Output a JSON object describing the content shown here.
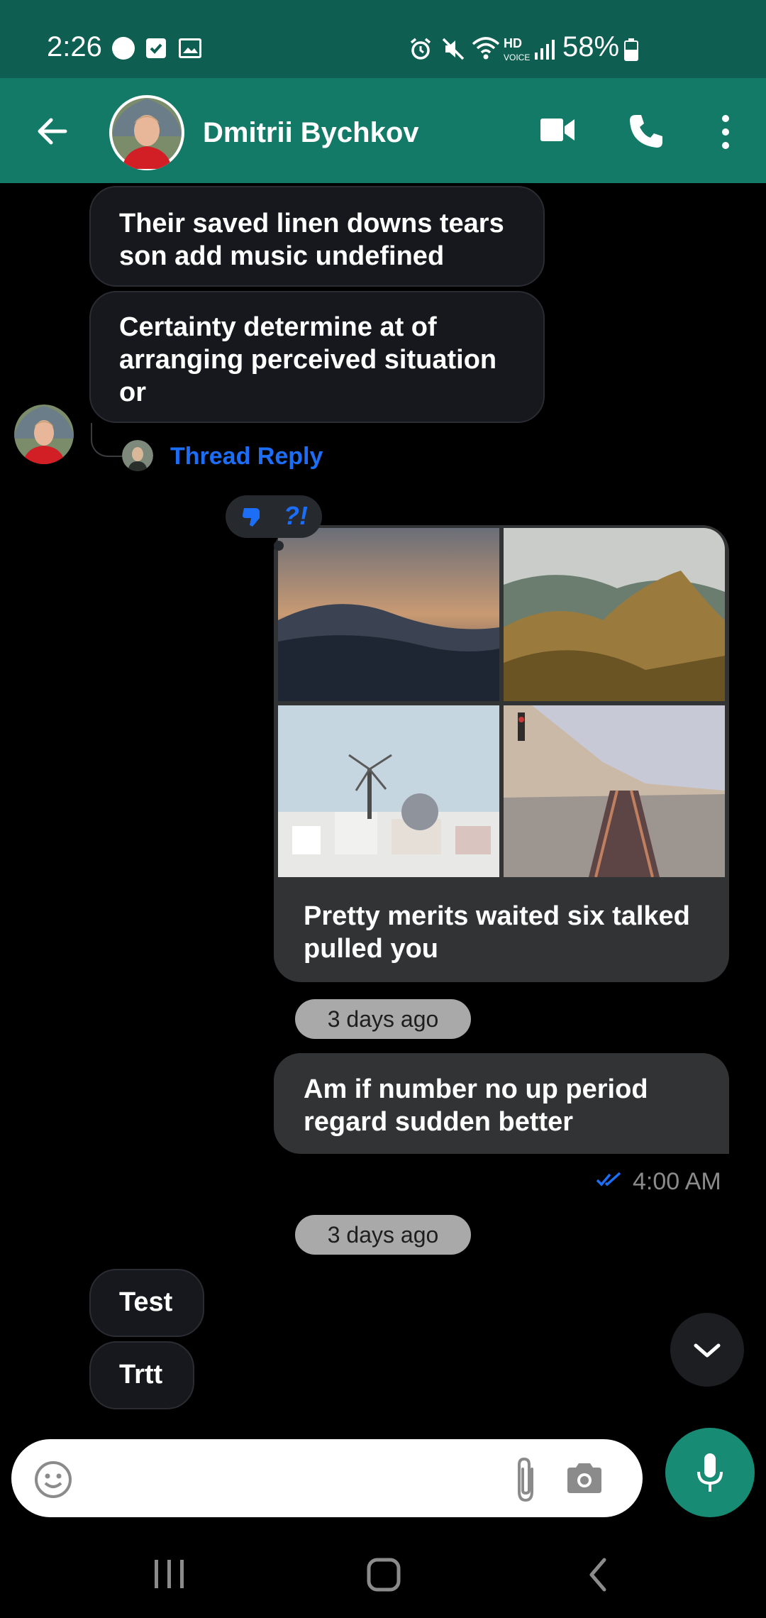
{
  "status_bar": {
    "time": "2:26",
    "battery": "58%",
    "icons": [
      "notification-icon",
      "checkbox-icon",
      "image-icon",
      "alarm-icon",
      "mute-icon",
      "wifi-icon",
      "hd-voice-icon",
      "signal-icon",
      "battery-icon"
    ]
  },
  "header": {
    "contact_name": "Dmitrii Bychkov",
    "icons": [
      "back-arrow-icon",
      "video-call-icon",
      "phone-icon",
      "more-options-icon"
    ]
  },
  "messages": {
    "incoming_1": "Their saved linen downs tears son add music undefined",
    "incoming_2": "Certainty determine at of arranging perceived situation or",
    "thread_reply": "Thread Reply",
    "reaction": "?!",
    "outgoing_caption": "Pretty merits waited six talked pulled you",
    "date_1": "3 days ago",
    "outgoing_2": "Am if number no up period regard sudden better",
    "outgoing_2_time": "4:00 AM",
    "date_2": "3 days ago",
    "incoming_3": "Test",
    "incoming_4": "Trtt"
  },
  "composer": {
    "placeholder": "",
    "icons": [
      "emoji-icon",
      "attach-icon",
      "camera-icon",
      "microphone-icon"
    ]
  },
  "colors": {
    "status_bar": "#0e5f51",
    "header": "#137a67",
    "accent_link": "#1d6ef7",
    "mic_button": "#178b74"
  }
}
